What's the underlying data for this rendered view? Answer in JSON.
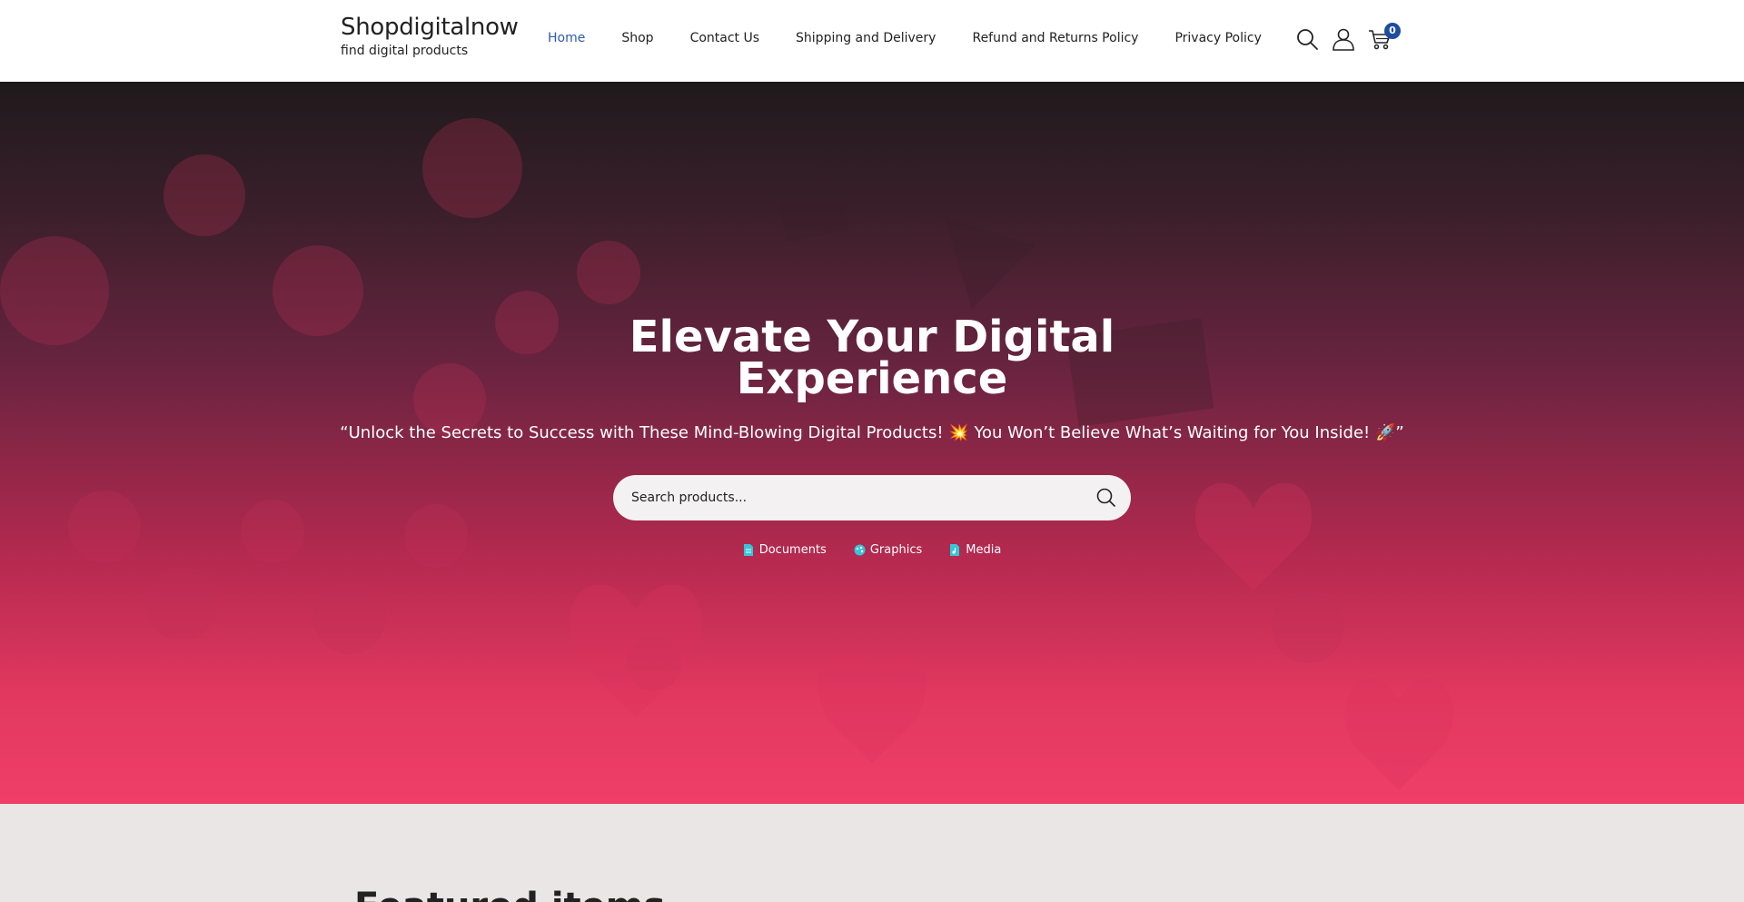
{
  "header": {
    "brand_title": "Shopdigitalnow",
    "brand_tagline": "find digital products",
    "nav": [
      {
        "label": "Home",
        "active": true
      },
      {
        "label": "Shop",
        "active": false
      },
      {
        "label": "Contact Us",
        "active": false
      },
      {
        "label": "Shipping and Delivery",
        "active": false
      },
      {
        "label": "Refund and Returns Policy",
        "active": false
      },
      {
        "label": "Privacy Policy",
        "active": false
      }
    ],
    "icons": [
      "search-icon",
      "user-icon",
      "cart-icon"
    ],
    "cart_count": "0"
  },
  "hero": {
    "title_line1": "Elevate Your Digital",
    "title_line2": "Experience",
    "subtitle": "“Unlock the Secrets to Success with These Mind-Blowing Digital Products! 💥 You Won’t Believe What’s Waiting for You Inside! 🚀”",
    "search_placeholder": "Search products...",
    "categories": [
      {
        "label": "Documents",
        "icon": "document-icon"
      },
      {
        "label": "Graphics",
        "icon": "graphics-icon"
      },
      {
        "label": "Media",
        "icon": "media-icon"
      }
    ]
  },
  "featured": {
    "title": "Featured items"
  },
  "colors": {
    "accent": "#1f4d9e",
    "nav_active": "#2f5aa8",
    "hero_bottom": "#ef3f68",
    "icon_cyan": "#35c6d8"
  }
}
